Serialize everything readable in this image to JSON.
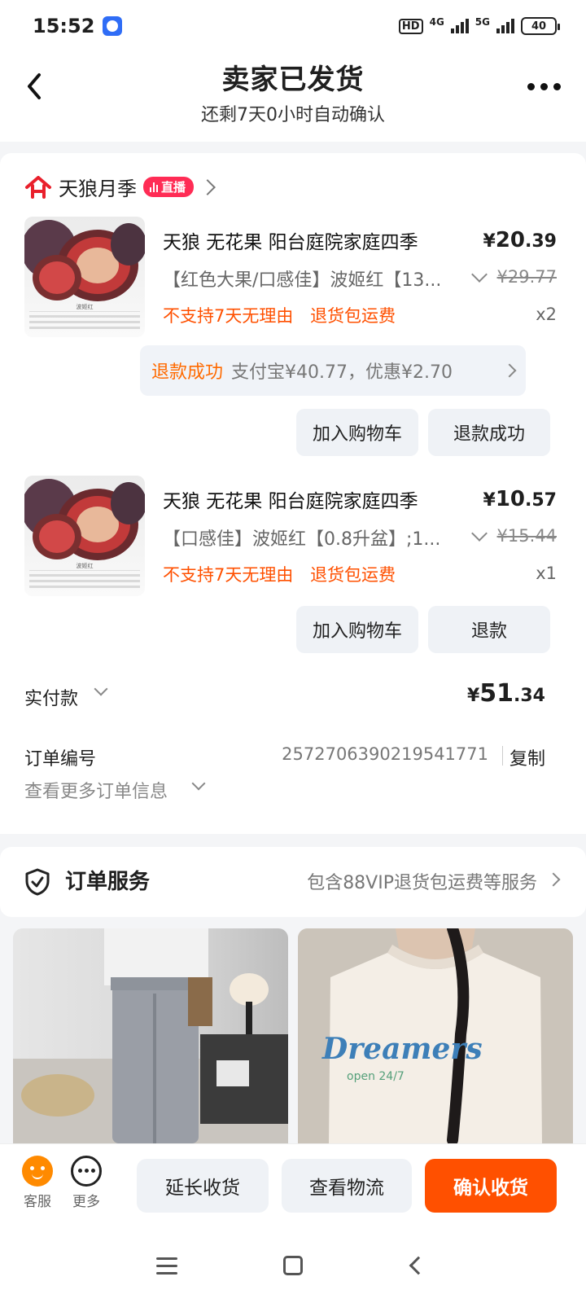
{
  "status_bar": {
    "time": "15:52",
    "hd": "HD",
    "net1": "4G",
    "net2": "5G",
    "battery": "40"
  },
  "header": {
    "title": "卖家已发货",
    "subtitle": "还剩7天0小时自动确认"
  },
  "shop": {
    "name": "天狼月季",
    "live_badge": "直播"
  },
  "items": [
    {
      "title": "天狼 无花果 阳台庭院家庭四季",
      "price_symbol": "¥",
      "price_int": "20",
      "price_dec": ".39",
      "sku": "【红色大果/口感佳】波姬红【13...",
      "original_price": "¥29.77",
      "tag1": "不支持7天无理由",
      "tag2": "退货包运费",
      "qty": "x2",
      "thumb_label": "波姬红",
      "refund_status": "退款成功",
      "refund_desc": "支付宝¥40.77，优惠¥2.70",
      "btn_left": "加入购物车",
      "btn_right": "退款成功"
    },
    {
      "title": "天狼 无花果 阳台庭院家庭四季",
      "price_symbol": "¥",
      "price_int": "10",
      "price_dec": ".57",
      "sku": "【口感佳】波姬红【0.8升盆】;1...",
      "original_price": "¥15.44",
      "tag1": "不支持7天无理由",
      "tag2": "退货包运费",
      "qty": "x1",
      "thumb_label": "波姬红",
      "btn_left": "加入购物车",
      "btn_right": "退款"
    }
  ],
  "payment": {
    "label": "实付款",
    "symbol": "¥",
    "amount_int": "51",
    "amount_dec": ".34"
  },
  "order": {
    "number_label": "订单编号",
    "number": "2572706390219541771",
    "copy_label": "复制",
    "more_info": "查看更多订单信息"
  },
  "service": {
    "title": "订单服务",
    "desc": "包含88VIP退货包运费等服务"
  },
  "feed": {
    "shirt_text": "Dreamers",
    "shirt_sub": "open 24/7"
  },
  "bottom_bar": {
    "kefu": "客服",
    "more": "更多",
    "extend": "延长收货",
    "logistics": "查看物流",
    "confirm": "确认收货"
  },
  "colors": {
    "accent": "#ff5000",
    "refund_ok": "#ff6a00",
    "live": "#ff2c55",
    "tmall": "#e9202c"
  }
}
